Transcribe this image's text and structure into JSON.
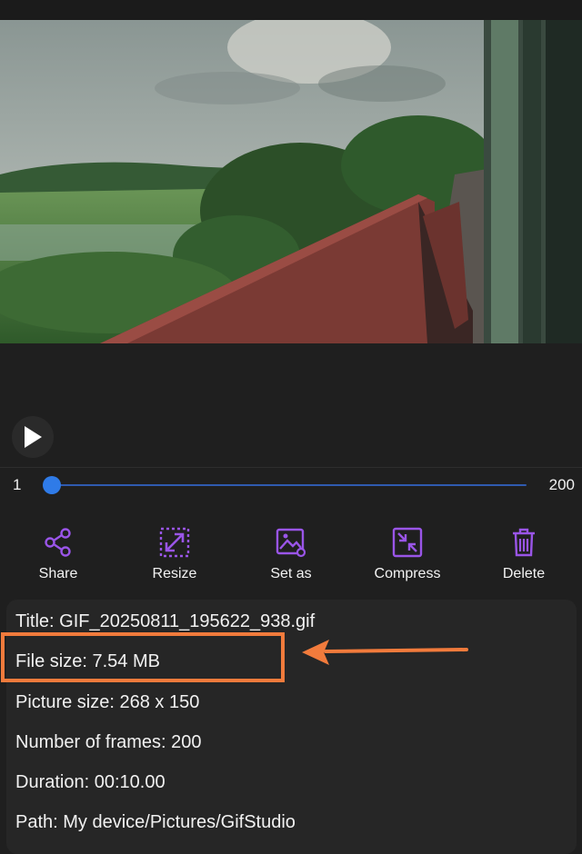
{
  "player": {
    "frame_start": "1",
    "frame_end": "200",
    "current_frame_fraction": 0
  },
  "actions": [
    {
      "label": "Share",
      "icon": "share-icon"
    },
    {
      "label": "Resize",
      "icon": "resize-icon"
    },
    {
      "label": "Set as",
      "icon": "image-icon"
    },
    {
      "label": "Compress",
      "icon": "compress-icon"
    },
    {
      "label": "Delete",
      "icon": "trash-icon"
    }
  ],
  "info": {
    "title": "Title: GIF_20250811_195622_938.gif",
    "file_size": "File size: 7.54 MB",
    "picture_size": "Picture size: 268 x 150",
    "frames": "Number of frames: 200",
    "duration": "Duration: 00:10.00",
    "path": "Path: My device/Pictures/GifStudio"
  },
  "colors": {
    "accent": "#9a55e8",
    "slider": "#2f7be8",
    "annotation": "#f27b3c",
    "background": "#1f1f1f"
  }
}
